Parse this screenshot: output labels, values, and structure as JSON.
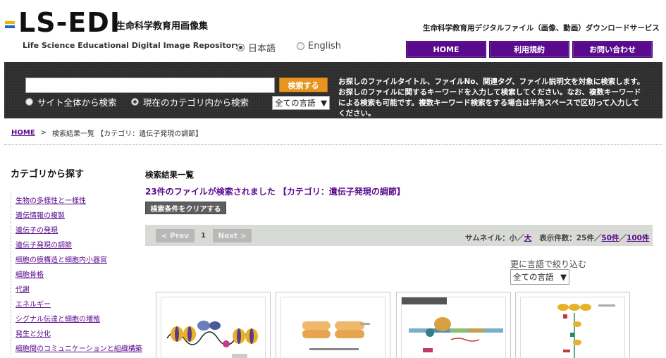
{
  "header": {
    "logo_text": "LS-EDI",
    "logo_jp": "生命科学教育用画像集",
    "logo_sub": "Life Science Educational Digital Image Repository",
    "service_text": "生命科学教育用デジタルファイル（画像、動画）ダウンロードサービス",
    "lang_options": [
      {
        "label": "日本語",
        "selected": true
      },
      {
        "label": "English",
        "selected": false
      }
    ],
    "nav": [
      {
        "label": "HOME"
      },
      {
        "label": "利用規約"
      },
      {
        "label": "お問い合わせ"
      }
    ],
    "brand_color": "#5a0a8c"
  },
  "search": {
    "input_value": "",
    "button_label": "検索する",
    "scope_options": [
      {
        "label": "サイト全体から検索",
        "selected": false
      },
      {
        "label": "現在のカテゴリ内から検索",
        "selected": true
      }
    ],
    "language_select": "全ての言語",
    "description": "お探しのファイルタイトル、ファイルNo、関連タグ、ファイル説明文を対象に検索します。お探しのファイルに関するキーワードを入力して検索してください。なお、複数キーワードによる検索も可能です。複数キーワード検索をする場合は半角スペースで区切って入力してください。"
  },
  "breadcrumb": {
    "home": "HOME",
    "sep": ">",
    "current": "検索結果一覧 【カテゴリ：遺伝子発現の調節】"
  },
  "sidebar": {
    "title": "カテゴリから探す",
    "items": [
      {
        "label": "生物の多様性と一様性"
      },
      {
        "label": "遺伝情報の複製"
      },
      {
        "label": "遺伝子の発現"
      },
      {
        "label": "遺伝子発現の調節"
      },
      {
        "label": "細胞の膜構造と細胞内小器官"
      },
      {
        "label": "細胞骨格"
      },
      {
        "label": "代謝"
      },
      {
        "label": "エネルギー"
      },
      {
        "label": "シグナル伝達と細胞の増殖"
      },
      {
        "label": "発生と分化"
      },
      {
        "label": "細胞間のコミュニケーションと組織構築"
      }
    ]
  },
  "main": {
    "result_title": "検索結果一覧",
    "result_count": "23件のファイルが検索されました 【カテゴリ：遺伝子発現の調節】",
    "clear_button": "検索条件をクリアする",
    "pager": {
      "prev": "< Prev",
      "page": "1",
      "next": "Next >",
      "thumb_label": "サムネイル：",
      "thumb_small": "小",
      "slash": "／",
      "thumb_large": "大",
      "per_page_label": "表示件数：",
      "per_25": "25件",
      "per_50": "50件",
      "per_100": "100件"
    },
    "refine_label": "更に言語で絞り込む",
    "refine_select": "全ての言語"
  }
}
